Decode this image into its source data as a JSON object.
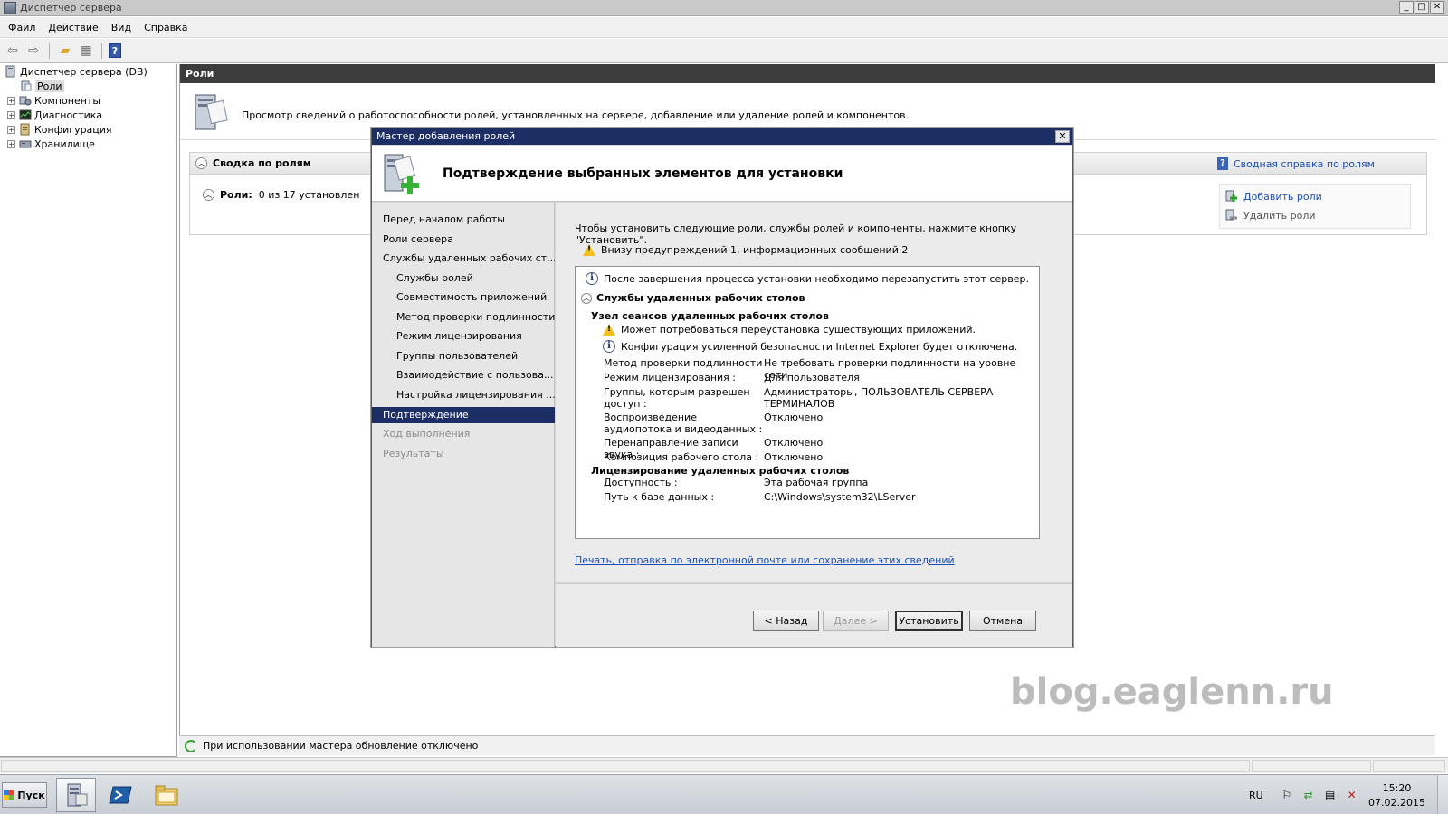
{
  "window": {
    "title": "Диспетчер сервера",
    "minimize": "_",
    "maximize": "□",
    "close": "✕"
  },
  "menu": [
    "Файл",
    "Действие",
    "Вид",
    "Справка"
  ],
  "tree": {
    "root": "Диспетчер сервера (DB)",
    "items": [
      "Роли",
      "Компоненты",
      "Диагностика",
      "Конфигурация",
      "Хранилище"
    ]
  },
  "roles_page": {
    "header": "Роли",
    "description": "Просмотр сведений о работоспособности ролей, установленных на сервере, добавление или удаление ролей и компонентов.",
    "summary_title": "Сводка по ролям",
    "help_link": "Сводная справка по ролям",
    "roles_label": "Роли:",
    "roles_count": "0 из 17 установлен",
    "actions": {
      "add": "Добавить роли",
      "remove": "Удалить роли"
    }
  },
  "watermark": "blog.eaglenn.ru",
  "status": {
    "text": "При использовании мастера обновление отключено"
  },
  "taskbar": {
    "start": "Пуск",
    "lang": "RU",
    "time": "15:20",
    "date": "07.02.2015"
  },
  "wizard": {
    "title": "Мастер добавления ролей",
    "close": "✕",
    "heading": "Подтверждение выбранных элементов для установки",
    "nav": [
      {
        "label": "Перед началом работы",
        "state": "normal",
        "indent": false
      },
      {
        "label": "Роли сервера",
        "state": "normal",
        "indent": false
      },
      {
        "label": "Службы удаленных рабочих ст...",
        "state": "normal",
        "indent": false
      },
      {
        "label": "Службы ролей",
        "state": "normal",
        "indent": true
      },
      {
        "label": "Совместимость приложений",
        "state": "normal",
        "indent": true
      },
      {
        "label": "Метод проверки подлинности",
        "state": "normal",
        "indent": true
      },
      {
        "label": "Режим лицензирования",
        "state": "normal",
        "indent": true
      },
      {
        "label": "Группы пользователей",
        "state": "normal",
        "indent": true
      },
      {
        "label": "Взаимодействие с пользова...",
        "state": "normal",
        "indent": true
      },
      {
        "label": "Настройка лицензирования ...",
        "state": "normal",
        "indent": true
      },
      {
        "label": "Подтверждение",
        "state": "selected",
        "indent": false
      },
      {
        "label": "Ход выполнения",
        "state": "disabled",
        "indent": false
      },
      {
        "label": "Результаты",
        "state": "disabled",
        "indent": false
      }
    ],
    "intro": "Чтобы установить следующие роли, службы ролей и компоненты, нажмите кнопку \"Установить\".",
    "warning_summary": "Внизу предупреждений 1, информационных сообщений 2",
    "details": {
      "restart_info": "После завершения процесса установки необходимо перезапустить этот сервер.",
      "section": "Службы удаленных рабочих столов",
      "node_title": "Узел сеансов удаленных рабочих столов",
      "warn_reinstall": "Может потребоваться переустановка существующих приложений.",
      "info_ie": "Конфигурация усиленной безопасности Internet Explorer будет отключена.",
      "kv": [
        {
          "k": "Метод проверки подлинности :",
          "v": "Не требовать проверки подлинности на уровне сети"
        },
        {
          "k": "Режим лицензирования :",
          "v": "Для пользователя"
        },
        {
          "k": "Группы, которым разрешен доступ :",
          "v": "Администраторы, ПОЛЬЗОВАТЕЛЬ СЕРВЕРА ТЕРМИНАЛОВ"
        },
        {
          "k": "Воспроизведение аудиопотока и видеоданных :",
          "v": "Отключено"
        },
        {
          "k": "Перенаправление записи звука :",
          "v": "Отключено"
        },
        {
          "k": "Композиция рабочего стола :",
          "v": "Отключено"
        }
      ],
      "licensing_title": "Лицензирование удаленных рабочих столов",
      "licensing_kv": [
        {
          "k": "Доступность :",
          "v": "Эта рабочая группа"
        },
        {
          "k": "Путь к базе данных :",
          "v": "C:\\Windows\\system32\\LServer"
        }
      ]
    },
    "print_link": "Печать, отправка по электронной почте или сохранение этих сведений",
    "buttons": {
      "back": "< Назад",
      "next": "Далее >",
      "install": "Установить",
      "cancel": "Отмена"
    }
  }
}
